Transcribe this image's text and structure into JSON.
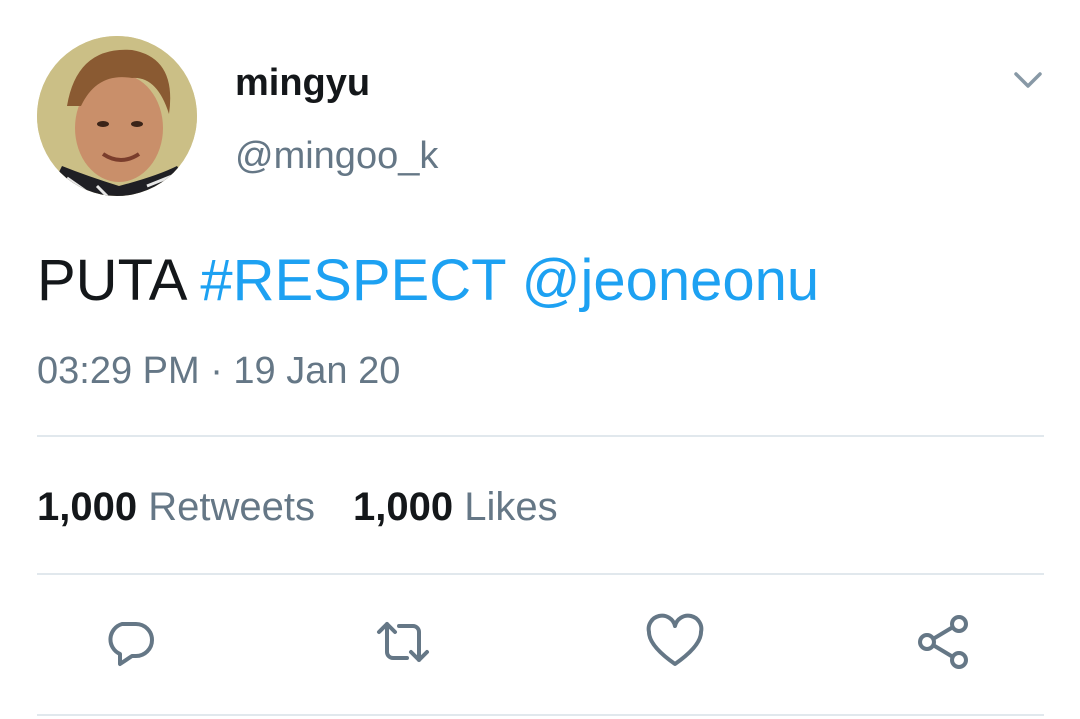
{
  "author": {
    "display_name": "mingyu",
    "handle": "@mingoo_k"
  },
  "tweet": {
    "text": "PUTA",
    "hashtag": "#RESPECT",
    "mention": "@jeoneonu",
    "timestamp": "03:29 PM · 19 Jan 20"
  },
  "stats": {
    "retweets_count": "1,000",
    "retweets_label": "Retweets",
    "likes_count": "1,000",
    "likes_label": "Likes"
  },
  "icons": {
    "menu": "chevron-down-icon",
    "reply": "reply-icon",
    "retweet": "retweet-icon",
    "like": "heart-icon",
    "share": "share-icon"
  },
  "colors": {
    "link": "#1da1f2",
    "secondary_text": "#657786",
    "primary_text": "#14171a",
    "divider": "#e1e8ed"
  }
}
